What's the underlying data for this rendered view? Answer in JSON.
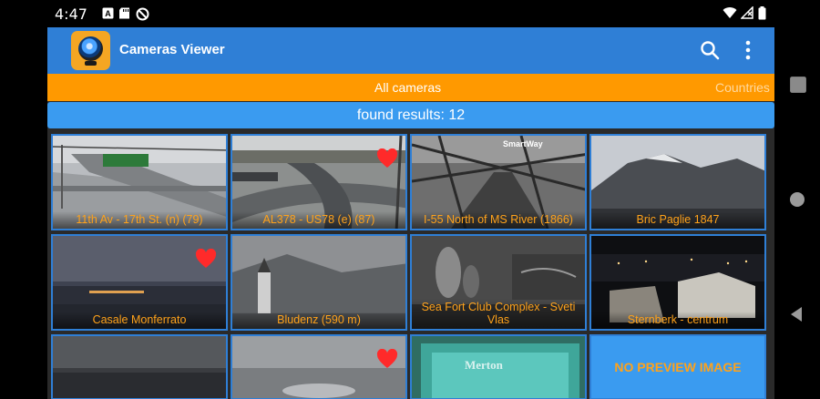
{
  "status_bar": {
    "time": "4:47"
  },
  "app": {
    "title": "Cameras Viewer",
    "tabs": [
      {
        "label": "All cameras",
        "selected": true
      },
      {
        "label": "Countries",
        "selected": false
      }
    ],
    "results_text": "found results: 12",
    "cameras": [
      {
        "caption": "11th Av - 17th St. (n) (79)",
        "favorite": false
      },
      {
        "caption": "AL378 - US78 (e) (87)",
        "favorite": true
      },
      {
        "caption": "I-55 North of MS River (1866)",
        "favorite": false,
        "watermark": "SmartWay"
      },
      {
        "caption": "Bric Paglie 1847",
        "favorite": false
      },
      {
        "caption": "Casale Monferrato",
        "favorite": true
      },
      {
        "caption": "Bludenz (590 m)",
        "favorite": false
      },
      {
        "caption": "Sea Fort Club Complex - Sveti Vlas",
        "favorite": false
      },
      {
        "caption": "Sternberk - centrum",
        "favorite": false
      },
      {
        "caption": "",
        "favorite": false
      },
      {
        "caption": "",
        "favorite": true
      },
      {
        "caption": "",
        "favorite": false,
        "watermark": "Merton"
      },
      {
        "caption": "",
        "favorite": false,
        "no_preview": "NO PREVIEW IMAGE"
      }
    ]
  },
  "colors": {
    "app_bar": "#2f7fd6",
    "tab_bar": "#ff9900",
    "results_bar": "#3a9bf0",
    "caption": "#ffa21a",
    "heart": "#ff2a2a"
  }
}
